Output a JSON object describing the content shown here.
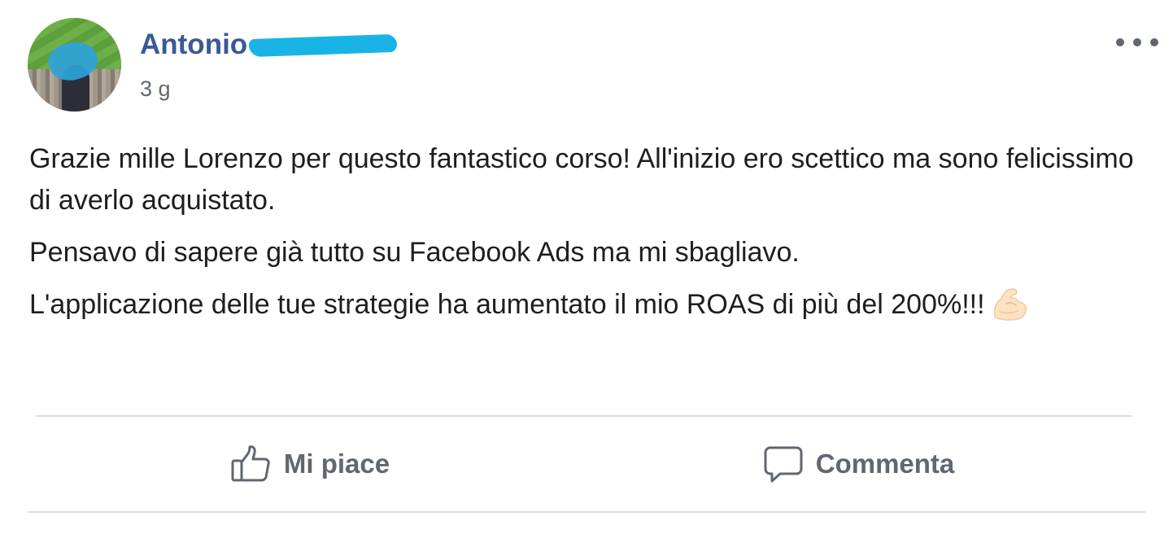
{
  "post": {
    "author": {
      "first_name": "Antonio",
      "last_name_redacted": true
    },
    "timestamp": "3 g",
    "more_options_icon": "ellipsis-icon",
    "paragraphs": [
      "Grazie mille Lorenzo per questo fantastico corso! All'inizio ero scettico ma sono felicissimo di averlo acquistato.",
      "Pensavo di sapere già tutto su Facebook Ads ma mi sbagliavo.",
      "L'applicazione delle tue strategie ha aumentato il mio ROAS di più del 200%!!!"
    ],
    "trailing_emoji": "flexed-biceps-icon"
  },
  "actions": {
    "like_label": "Mi piace",
    "like_icon": "thumbs-up-icon",
    "comment_label": "Commenta",
    "comment_icon": "comment-bubble-icon"
  },
  "colors": {
    "author_link": "#3b5998",
    "secondary_text": "#606770",
    "body_text": "#1c1e21",
    "divider": "#dadde1",
    "redaction_scribble": "#1ab3e6"
  }
}
